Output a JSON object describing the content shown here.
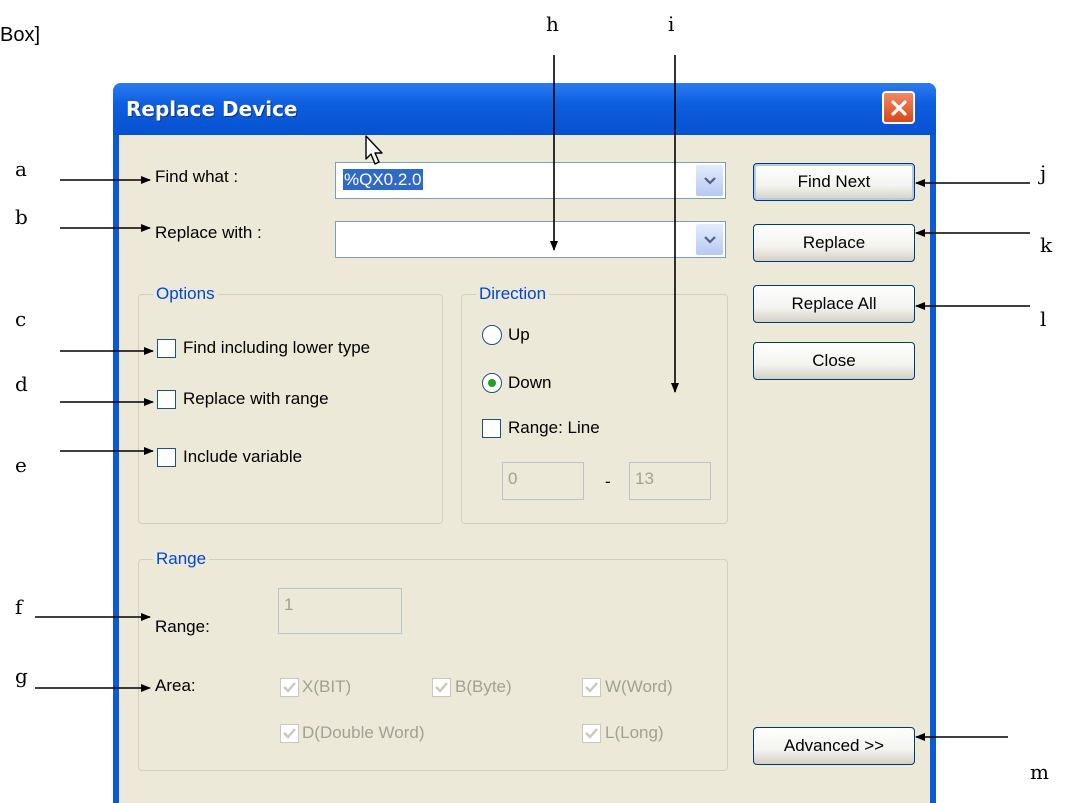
{
  "page": {
    "header_fragment": "Box]"
  },
  "callouts": {
    "a": "a",
    "b": "b",
    "c": "c",
    "d": "d",
    "e": "e",
    "f": "f",
    "g": "g",
    "h": "h",
    "i": "i",
    "j": "j",
    "k": "k",
    "l": "l",
    "m": "m"
  },
  "dialog": {
    "title": "Replace Device",
    "find_what": {
      "label": "Find what :",
      "value": "%QX0.2.0"
    },
    "replace_with": {
      "label": "Replace with :",
      "value": ""
    },
    "options": {
      "title": "Options",
      "items": [
        {
          "label": "Find including lower type",
          "checked": false
        },
        {
          "label": "Replace with range",
          "checked": false
        },
        {
          "label": "Include variable",
          "checked": false
        }
      ]
    },
    "direction": {
      "title": "Direction",
      "up_label": "Up",
      "down_label": "Down",
      "selected": "Down",
      "range_line_label": "Range: Line",
      "range_line_checked": false,
      "line_from": "0",
      "line_separator": "-",
      "line_to": "13"
    },
    "range_group": {
      "title": "Range",
      "range_label": "Range:",
      "range_value": "1",
      "area_label": "Area:",
      "area_items": [
        {
          "label": "X(BIT)",
          "checked": true
        },
        {
          "label": "B(Byte)",
          "checked": true
        },
        {
          "label": "W(Word)",
          "checked": true
        },
        {
          "label": "D(Double Word)",
          "checked": true
        },
        {
          "label": "L(Long)",
          "checked": true
        }
      ]
    },
    "buttons": {
      "find_next": "Find Next",
      "replace": "Replace",
      "replace_all": "Replace All",
      "close": "Close",
      "advanced": "Advanced >>"
    }
  },
  "icons": {
    "close": "close-icon",
    "combo_arrow": "chevron-down-icon",
    "cursor": "mouse-cursor-icon",
    "check": "checkmark-icon"
  },
  "colors": {
    "titlebar": "#0a5ad8",
    "dialog_bg": "#ece9d8",
    "group_title": "#0046d5",
    "selection": "#316ac5",
    "close_button": "#d8461c"
  }
}
